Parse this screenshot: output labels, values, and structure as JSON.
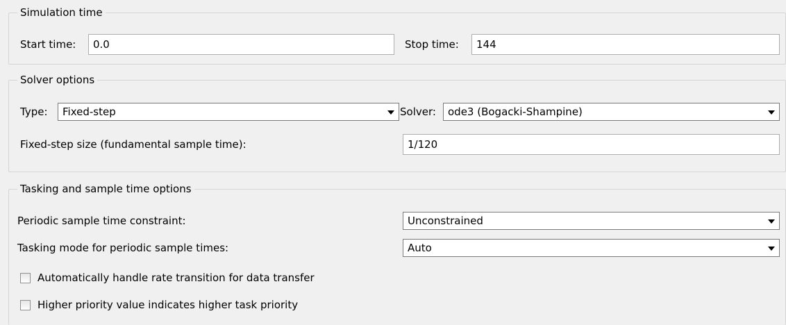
{
  "simulation_time": {
    "title": "Simulation time",
    "start_label": "Start time:",
    "start_value": "0.0",
    "stop_label": "Stop time:",
    "stop_value": "144"
  },
  "solver_options": {
    "title": "Solver options",
    "type_label": "Type:",
    "type_value": "Fixed-step",
    "solver_label": "Solver:",
    "solver_value": "ode3 (Bogacki-Shampine)",
    "step_label": "Fixed-step size (fundamental sample time):",
    "step_value": "1/120"
  },
  "tasking": {
    "title": "Tasking and sample time options",
    "periodic_label": "Periodic sample time constraint:",
    "periodic_value": "Unconstrained",
    "mode_label": "Tasking mode for periodic sample times:",
    "mode_value": "Auto",
    "rate_transition_label": "Automatically handle rate transition for data transfer",
    "rate_transition_checked": false,
    "priority_label": "Higher priority value indicates higher task priority",
    "priority_checked": false
  }
}
